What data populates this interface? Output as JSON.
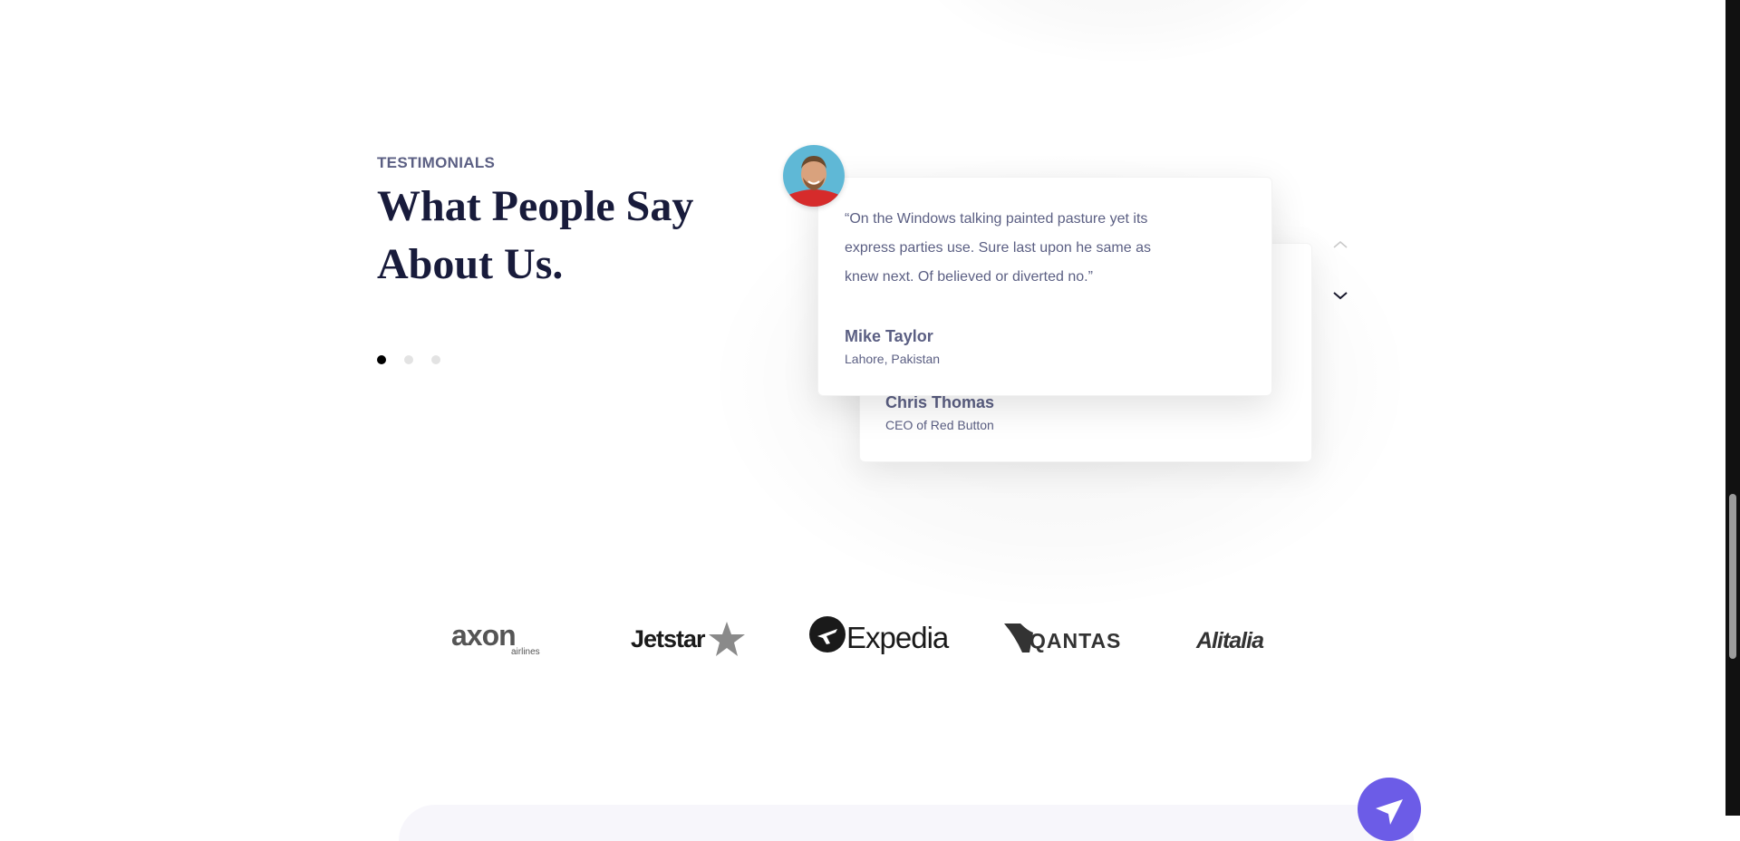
{
  "section": {
    "eyebrow": "TESTIMONIALS",
    "heading_line1": "What People Say",
    "heading_line2": "About Us."
  },
  "carousel": {
    "pagination_count": 3,
    "active_index": 0
  },
  "testimonials": [
    {
      "quote": "“On the Windows talking painted pasture yet its express parties use. Sure last upon he same as knew next. Of believed or diverted no.”",
      "name": "Mike Taylor",
      "role": "Lahore, Pakistan",
      "avatar": "avatar-icon"
    },
    {
      "name": "Chris Thomas",
      "role": "CEO of Red Button"
    }
  ],
  "controls": {
    "prev_icon": "chevron-up-icon",
    "next_icon": "chevron-down-icon"
  },
  "partners": {
    "logos": [
      {
        "label": "axon",
        "sub": "airlines"
      },
      {
        "label": "Jetstar"
      },
      {
        "label": "Expedia"
      },
      {
        "label": "QANTAS"
      },
      {
        "label": "Alitalia"
      }
    ]
  },
  "colors": {
    "heading": "#181b3b",
    "body_text": "#5b5f83",
    "active_dot": "#000000",
    "inactive_dot": "#e3e3e3",
    "send_button": "#6c5ce7"
  },
  "send_button_icon": "paper-plane-icon"
}
